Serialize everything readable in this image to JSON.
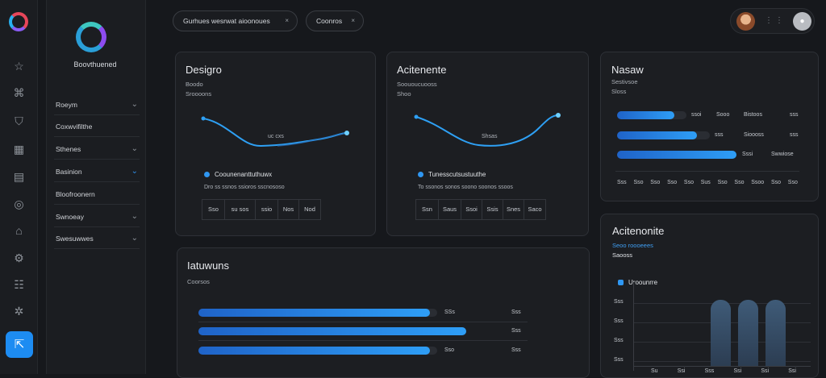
{
  "sidebar": {
    "brand": "Boovthuened",
    "items": [
      {
        "label": "Roeym",
        "chev": "⌄"
      },
      {
        "label": "Coxwvifilthe",
        "chev": ""
      },
      {
        "label": "Sthenes",
        "chev": "⌄"
      },
      {
        "label": "Basinion",
        "chev": "⌄"
      },
      {
        "label": "Bloofroonern",
        "chev": ""
      },
      {
        "label": "Swnoeay",
        "chev": "⌄"
      },
      {
        "label": "Swesuwwes",
        "chev": "⌄"
      }
    ]
  },
  "header": {
    "pill1": "Gurhues wesrwat aioonoues",
    "pill2": "Coonros",
    "close": "×"
  },
  "card_design": {
    "title": "Desigro",
    "sub1": "Boodo",
    "sub2": "Sroooons",
    "chart_label": "uc cxs",
    "legend": "Coounenanttuthuwx",
    "meta": "Dro  ss  ssnos  ssioros  sscnososo",
    "table": [
      "Sso",
      "su sos",
      "ssio",
      "Nos",
      "Nod"
    ]
  },
  "card_activity": {
    "title": "Acitenente",
    "sub1": "Soououcuooss",
    "sub2": "Shoo",
    "chart_label": "Shsas",
    "legend": "Tunesscutsustuuthe",
    "meta": "To  ssonos  sonos  soono  soonos  ssoos",
    "table": [
      "Ssn",
      "Saus",
      "Ssoi",
      "Ssis",
      "Snes",
      "Saco"
    ]
  },
  "card_nasaw": {
    "title": "Nasaw",
    "sub1": "Sestivsoe",
    "sub2": "Sloss",
    "rows": [
      {
        "value": 0.83,
        "a": "ssoi",
        "b": "Sooo",
        "c": "Bistoos",
        "d": "sss"
      },
      {
        "value": 0.86,
        "a": "sss",
        "b": "",
        "c": "Sioooss",
        "d": "sss"
      },
      {
        "value": 1.0,
        "a": "",
        "b": "Sssi",
        "c": "Swwiose",
        "d": "sss"
      }
    ],
    "axis": [
      "Sss",
      "Sso",
      "Sso",
      "Sso",
      "Sso",
      "Sus",
      "Sso",
      "Sso",
      "Ssoo",
      "Sso",
      "Sso"
    ]
  },
  "card_bottom": {
    "title": "Iatuwuns",
    "sub": "Coorsos",
    "rows": [
      {
        "value": 0.97,
        "a": "SSs",
        "b": "Sss"
      },
      {
        "value": 1.0,
        "a": "",
        "b": "Sss"
      },
      {
        "value": 0.97,
        "a": "Sso",
        "b": "Sss"
      }
    ]
  },
  "card_right": {
    "title": "Acitenonite",
    "sub1": "Seoo roooeees",
    "sub2": "Saooss",
    "legend": "Uroounrre",
    "yticks": [
      "Sss",
      "Sss",
      "Sss",
      "Sss"
    ],
    "xticks": [
      "Su",
      "Ssi",
      "Sss",
      "Ssi",
      "Ssi",
      "Ssi"
    ],
    "columns": [
      0.82,
      0.82,
      0.82
    ]
  },
  "colors": {
    "accent": "#1d8cf2",
    "line": "#2ea0f4"
  }
}
